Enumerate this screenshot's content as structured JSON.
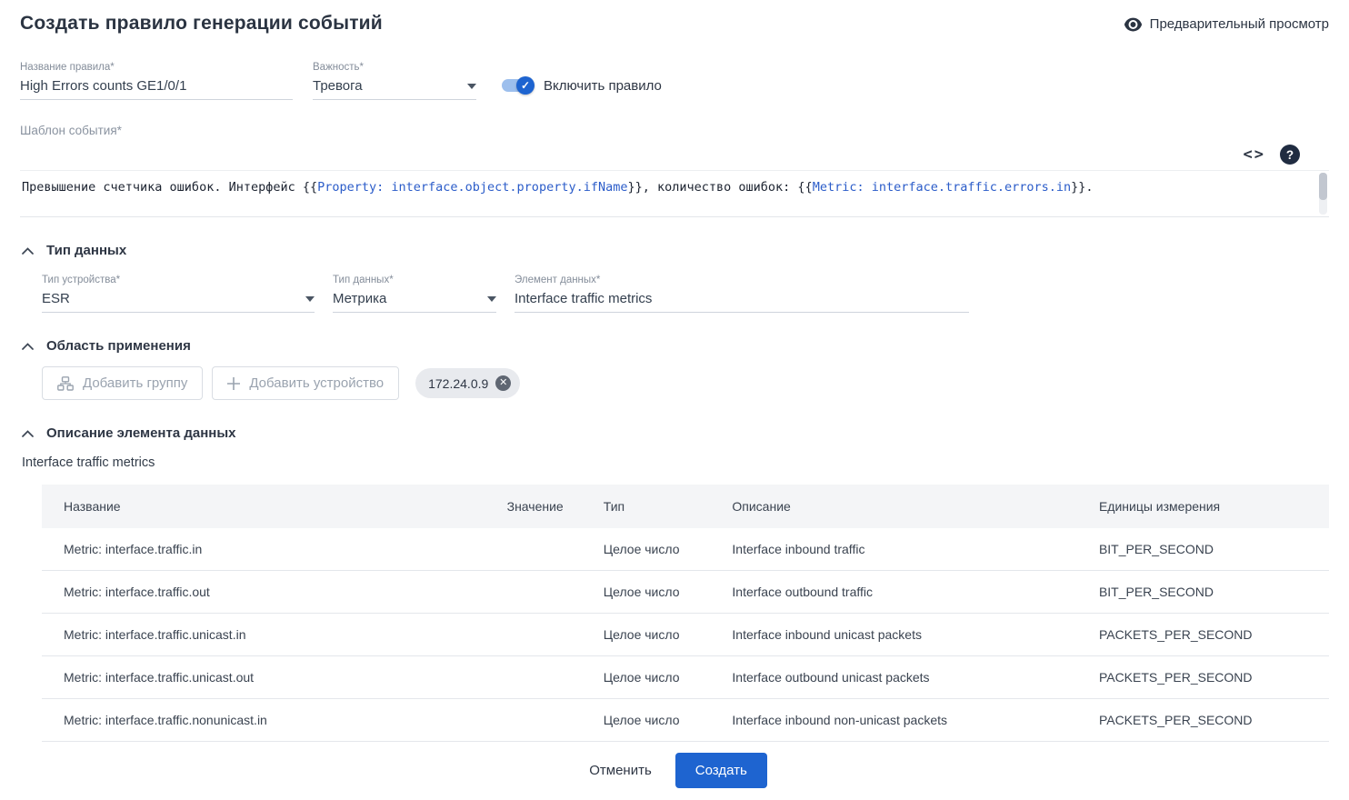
{
  "header": {
    "title": "Создать правило генерации событий",
    "preview_label": "Предварительный просмотр"
  },
  "fields": {
    "name": {
      "label": "Название правила*",
      "value": "High Errors counts GE1/0/1"
    },
    "severity": {
      "label": "Важность*",
      "value": "Тревога"
    },
    "enable": {
      "label": "Включить правило",
      "checked": true
    },
    "template_label": "Шаблон события*"
  },
  "template": {
    "segments": [
      {
        "type": "plain",
        "text": "Превышение счетчика ошибок. Интерфейс {{"
      },
      {
        "type": "token",
        "text": "Property: interface.object.property.ifName"
      },
      {
        "type": "plain",
        "text": "}}, количество ошибок: {{"
      },
      {
        "type": "token",
        "text": "Metric: interface.traffic.errors.in"
      },
      {
        "type": "plain",
        "text": "}}."
      }
    ]
  },
  "sections": {
    "data_type": {
      "title": "Тип данных",
      "device_type": {
        "label": "Тип устройства*",
        "value": "ESR"
      },
      "data_kind": {
        "label": "Тип данных*",
        "value": "Метрика"
      },
      "data_element": {
        "label": "Элемент данных*",
        "value": "Interface traffic metrics"
      }
    },
    "scope": {
      "title": "Область применения",
      "add_group_label": "Добавить группу",
      "add_device_label": "Добавить устройство",
      "chip": "172.24.0.9"
    },
    "description": {
      "title": "Описание элемента данных",
      "subtitle": "Interface traffic metrics"
    }
  },
  "table": {
    "headers": [
      "Название",
      "Значение",
      "Тип",
      "Описание",
      "Единицы измерения"
    ],
    "rows": [
      [
        "Metric: interface.traffic.in",
        "",
        "Целое число",
        "Interface inbound traffic",
        "BIT_PER_SECOND"
      ],
      [
        "Metric: interface.traffic.out",
        "",
        "Целое число",
        "Interface outbound traffic",
        "BIT_PER_SECOND"
      ],
      [
        "Metric: interface.traffic.unicast.in",
        "",
        "Целое число",
        "Interface inbound unicast packets",
        "PACKETS_PER_SECOND"
      ],
      [
        "Metric: interface.traffic.unicast.out",
        "",
        "Целое число",
        "Interface outbound unicast packets",
        "PACKETS_PER_SECOND"
      ],
      [
        "Metric: interface.traffic.nonunicast.in",
        "",
        "Целое число",
        "Interface inbound non-unicast packets",
        "PACKETS_PER_SECOND"
      ]
    ]
  },
  "actions": {
    "cancel": "Отменить",
    "create": "Создать"
  },
  "colors": {
    "accent": "#1e64d0",
    "token_blue": "#2b5cc9",
    "table_header_bg": "#f4f5f7"
  }
}
